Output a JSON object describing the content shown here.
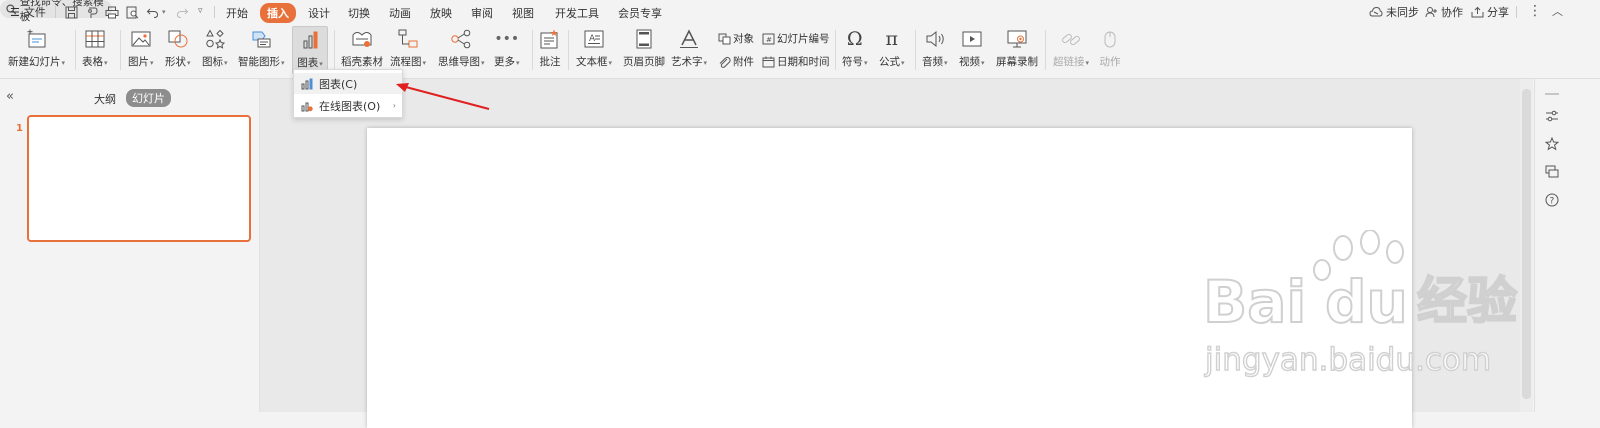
{
  "topbar": {
    "file_menu": "文件",
    "tabs": [
      {
        "label": "开始",
        "active": false
      },
      {
        "label": "插入",
        "active": true
      },
      {
        "label": "设计",
        "active": false
      },
      {
        "label": "切换",
        "active": false
      },
      {
        "label": "动画",
        "active": false
      },
      {
        "label": "放映",
        "active": false
      },
      {
        "label": "审阅",
        "active": false
      },
      {
        "label": "视图",
        "active": false
      },
      {
        "label": "开发工具",
        "active": false
      },
      {
        "label": "会员专享",
        "active": false
      }
    ],
    "search_placeholder": "查找命令、搜索模板",
    "sync_label": "未同步",
    "collab_label": "协作",
    "share_label": "分享"
  },
  "ribbon": {
    "new_slide": "新建幻灯片",
    "table": "表格",
    "picture": "图片",
    "shape": "形状",
    "icon": "图标",
    "smart_graphic": "智能图形",
    "chart": "图表",
    "docer_material": "稻壳素材",
    "flowchart": "流程图",
    "mindmap": "思维导图",
    "more": "更多",
    "comment": "批注",
    "textbox": "文本框",
    "header_footer": "页眉页脚",
    "wordart": "艺术字",
    "object": "对象",
    "attachment": "附件",
    "slide_number": "幻灯片编号",
    "date_time": "日期和时间",
    "symbol": "符号",
    "formula": "公式",
    "audio": "音频",
    "video": "视频",
    "screen_record": "屏幕录制",
    "hyperlink": "超链接",
    "action": "动作"
  },
  "left_panel": {
    "outline_tab": "大纲",
    "slides_tab": "幻灯片",
    "slide_number": "1"
  },
  "dropdown": {
    "items": [
      {
        "label": "图表(C)",
        "has_submenu": false
      },
      {
        "label": "在线图表(O)",
        "has_submenu": true
      }
    ]
  },
  "watermark": {
    "brand": "Bai",
    "brand2": "du",
    "cn": "经验",
    "url": "jingyan.baidu.com"
  },
  "colors": {
    "accent": "#e8703a",
    "annotation_arrow": "#e02020"
  }
}
